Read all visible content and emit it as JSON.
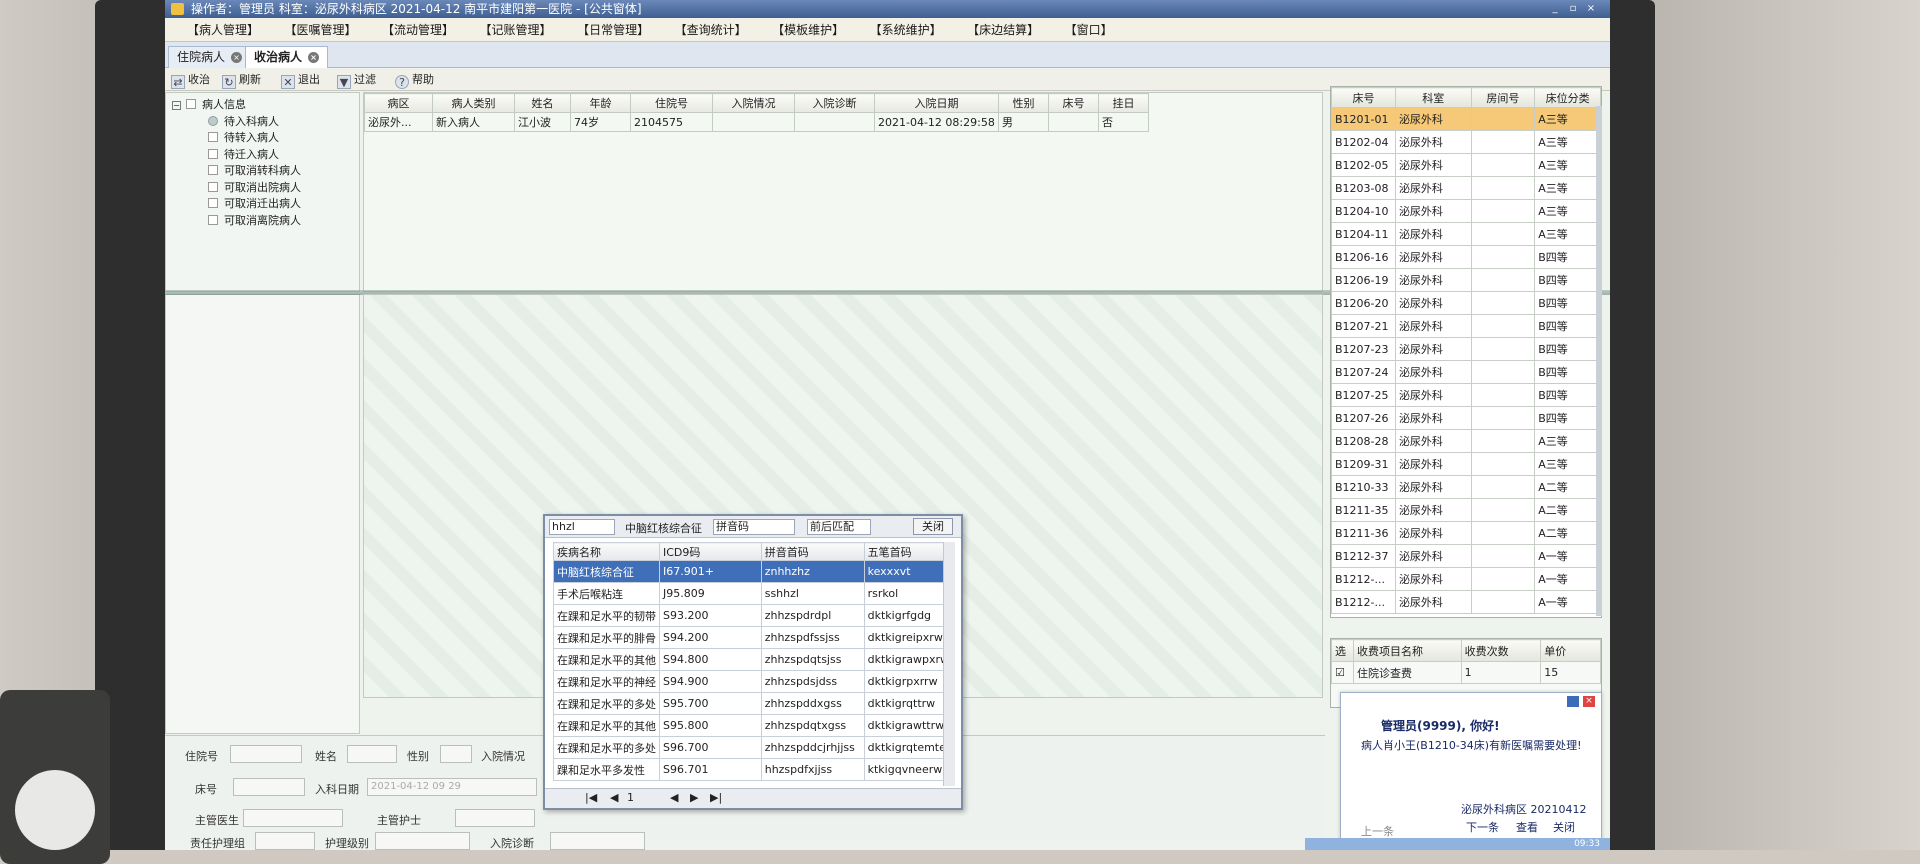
{
  "window": {
    "title": "操作者：管理员  科室：泌尿外科病区  2021-04-12  南平市建阳第一医院 - [公共窗体]",
    "controls": [
      "_",
      "▫",
      "×"
    ]
  },
  "menu": [
    "【病人管理】",
    "【医嘱管理】",
    "【流动管理】",
    "【记账管理】",
    "【日常管理】",
    "【查询统计】",
    "【模板维护】",
    "【系统维护】",
    "【床边结算】",
    "【窗口】"
  ],
  "tabs": [
    {
      "label": "住院病人"
    },
    {
      "label": "收治病人"
    }
  ],
  "toolbar": [
    {
      "label": "收治",
      "icon": "admit-icon"
    },
    {
      "label": "刷新",
      "icon": "refresh-icon"
    },
    {
      "label": "退出",
      "icon": "exit-icon"
    },
    {
      "label": "过滤",
      "icon": "filter-icon"
    },
    {
      "label": "帮助",
      "icon": "help-icon"
    }
  ],
  "tree": {
    "root": "病人信息",
    "items": [
      "待入科病人",
      "待转入病人",
      "待迁入病人",
      "可取消转科病人",
      "可取消出院病人",
      "可取消迁出病人",
      "可取消离院病人"
    ]
  },
  "patient_table": {
    "columns": [
      "病区",
      "病人类别",
      "姓名",
      "年龄",
      "住院号",
      "入院情况",
      "入院诊断",
      "入院日期",
      "性别",
      "床号",
      "挂日"
    ],
    "rows": [
      [
        "泌尿外...",
        "新入病人",
        "江小波",
        "74岁",
        "2104575",
        "",
        "",
        "2021-04-12 08:29:58",
        "男",
        "",
        "否"
      ]
    ]
  },
  "bed_table": {
    "columns": [
      "床号",
      "科室",
      "房间号",
      "床位分类"
    ],
    "rows": [
      [
        "B1201-01",
        "泌尿外科",
        "",
        "A三等"
      ],
      [
        "B1202-04",
        "泌尿外科",
        "",
        "A三等"
      ],
      [
        "B1202-05",
        "泌尿外科",
        "",
        "A三等"
      ],
      [
        "B1203-08",
        "泌尿外科",
        "",
        "A三等"
      ],
      [
        "B1204-10",
        "泌尿外科",
        "",
        "A三等"
      ],
      [
        "B1204-11",
        "泌尿外科",
        "",
        "A三等"
      ],
      [
        "B1206-16",
        "泌尿外科",
        "",
        "B四等"
      ],
      [
        "B1206-19",
        "泌尿外科",
        "",
        "B四等"
      ],
      [
        "B1206-20",
        "泌尿外科",
        "",
        "B四等"
      ],
      [
        "B1207-21",
        "泌尿外科",
        "",
        "B四等"
      ],
      [
        "B1207-23",
        "泌尿外科",
        "",
        "B四等"
      ],
      [
        "B1207-24",
        "泌尿外科",
        "",
        "B四等"
      ],
      [
        "B1207-25",
        "泌尿外科",
        "",
        "B四等"
      ],
      [
        "B1207-26",
        "泌尿外科",
        "",
        "B四等"
      ],
      [
        "B1208-28",
        "泌尿外科",
        "",
        "A三等"
      ],
      [
        "B1209-31",
        "泌尿外科",
        "",
        "A三等"
      ],
      [
        "B1210-33",
        "泌尿外科",
        "",
        "A二等"
      ],
      [
        "B1211-35",
        "泌尿外科",
        "",
        "A二等"
      ],
      [
        "B1211-36",
        "泌尿外科",
        "",
        "A二等"
      ],
      [
        "B1212-37",
        "泌尿外科",
        "",
        "A一等"
      ],
      [
        "B1212-...",
        "泌尿外科",
        "",
        "A一等"
      ],
      [
        "B1212-...",
        "泌尿外科",
        "",
        "A一等"
      ]
    ]
  },
  "fee_table": {
    "columns": [
      "选",
      "收费项目名称",
      "收费次数",
      "单价"
    ],
    "rows": [
      [
        "☑",
        "住院诊查费",
        "1",
        "15"
      ]
    ]
  },
  "form": {
    "inpatient_no": "住院号",
    "name": "姓名",
    "gender": "性别",
    "admit_status": "入院情况",
    "bed_no": "床号",
    "dept_date_label": "入科日期",
    "dept_date_value": "2021-04-12  09  29",
    "attending_doctor": "主管医生",
    "attending_nurse": "主管护士",
    "duty_group": "责任护理组",
    "care_level": "护理级别",
    "admit_diag": "入院诊断"
  },
  "diag_popup": {
    "search_value": "hhzl",
    "selected_label": "中脑红核综合征",
    "code_type": "拼音码",
    "match_mode": "前后匹配",
    "close_label": "关闭",
    "columns": [
      "疾病名称",
      "ICD9码",
      "拼音首码",
      "五笔首码"
    ],
    "rows": [
      [
        "中脑红核综合征",
        "I67.901+",
        "znhhzhz",
        "kexxxvt"
      ],
      [
        "手术后喉粘连",
        "J95.809",
        "sshhzl",
        "rsrkol"
      ],
      [
        "在踝和足水平的韧带",
        "S93.200",
        "zhhzspdrdpl",
        "dktkigrfgdg"
      ],
      [
        "在踝和足水平的腓骨",
        "S94.200",
        "zhhzspdfssjss",
        "dktkigreipxrw"
      ],
      [
        "在踝和足水平的其他",
        "S94.800",
        "zhhzspdqtsjss",
        "dktkigrawpxrw"
      ],
      [
        "在踝和足水平的神经",
        "S94.900",
        "zhhzspdsjdss",
        "dktkigrpxrrw"
      ],
      [
        "在踝和足水平的多处",
        "S95.700",
        "zhhzspddxgss",
        "dktkigrqttrw"
      ],
      [
        "在踝和足水平的其他",
        "S95.800",
        "zhhzspdqtxgss",
        "dktkigrawttrw"
      ],
      [
        "在踝和足水平的多处",
        "S96.700",
        "zhhzspddcjrhjjss",
        "dktkigrqtemte"
      ],
      [
        "踝和足水平多发性",
        "S96.701",
        "hhzspdfxjjss",
        "ktkigqvneerw"
      ]
    ],
    "page": "1"
  },
  "notification": {
    "greeting": "管理员(9999), 你好!",
    "message": "病人肖小王(B1210-34床)有新医嘱需要处理!",
    "footer": "泌尿外科病区  20210412",
    "prev": "上一条",
    "next": "下一条",
    "view": "查看",
    "close": "关闭"
  },
  "clock": "09:33",
  "colors": {
    "selected_row": "#f5c977",
    "popup_selected": "#3e6fb8",
    "titlebar": "#4a6aa0"
  }
}
